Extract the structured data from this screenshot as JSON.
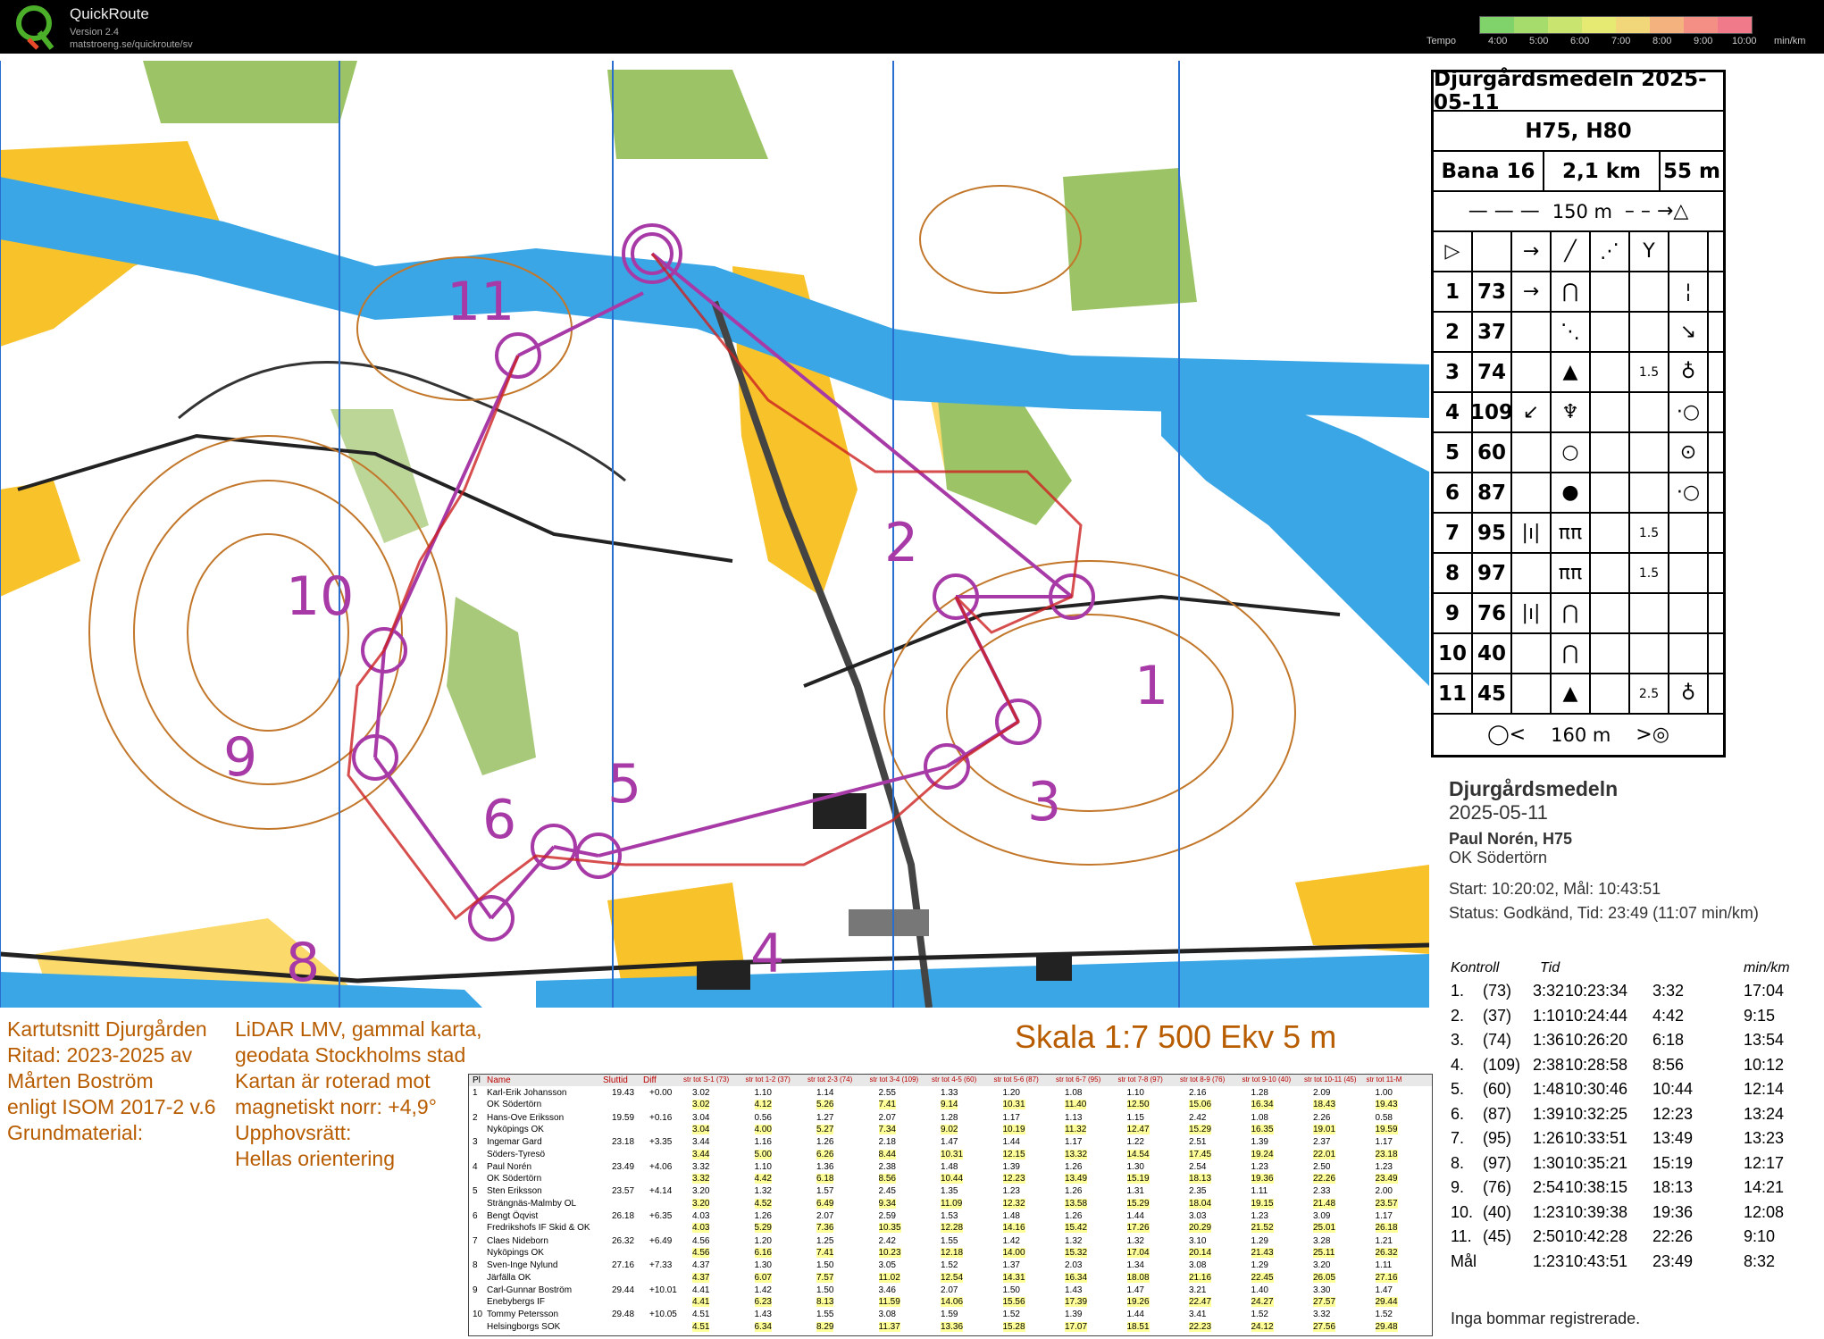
{
  "app": {
    "title": "QuickRoute",
    "version": "Version 2.4",
    "url": "matstroeng.se/quickroute/sv"
  },
  "tempo": {
    "label": "Tempo",
    "ticks": [
      "4:00",
      "5:00",
      "6:00",
      "7:00",
      "8:00",
      "9:00",
      "10:00"
    ],
    "unit": "min/km",
    "colors": [
      "#7fd36a",
      "#a6dc6c",
      "#c9e56f",
      "#e6ea73",
      "#f2d67a",
      "#f4b27f",
      "#f38f84",
      "#f17a8a"
    ]
  },
  "map_notes": {
    "left": [
      "Kartutsnitt Djurgården",
      "Ritad: 2023-2025 av",
      "Mårten Boström",
      "enligt ISOM 2017-2 v.6",
      "Grundmaterial:"
    ],
    "right": [
      "LiDAR LMV, gammal karta,",
      "geodata Stockholms stad",
      "Kartan är roterad mot",
      "magnetiskt norr: +4,9°",
      "Upphovsrätt:",
      "Hellas orientering"
    ],
    "scale": "Skala 1:7 500 Ekv 5 m",
    "control_numbers": [
      "1",
      "2",
      "3",
      "4",
      "5",
      "6",
      "8",
      "9",
      "10",
      "11"
    ]
  },
  "description": {
    "title": "Djurgårdsmedeln 2025-05-11",
    "classes": "H75, H80",
    "course": "Bana 16",
    "length": "2,1 km",
    "climb": "55 m",
    "start_marking": "150 m",
    "finish_marking": "160 m",
    "controls": [
      {
        "no": "1",
        "code": "73",
        "c": "→",
        "d": "⋂",
        "e": "",
        "f": "",
        "h": "¦"
      },
      {
        "no": "2",
        "code": "37",
        "c": "",
        "d": "⋱",
        "e": "",
        "f": "",
        "h": "↘"
      },
      {
        "no": "3",
        "code": "74",
        "c": "",
        "d": "▲",
        "e": "",
        "f": "1.5",
        "h": "♁"
      },
      {
        "no": "4",
        "code": "109",
        "c": "↙",
        "d": "♆",
        "e": "",
        "f": "",
        "h": "·○"
      },
      {
        "no": "5",
        "code": "60",
        "c": "",
        "d": "○",
        "e": "",
        "f": "",
        "h": "⊙"
      },
      {
        "no": "6",
        "code": "87",
        "c": "",
        "d": "●",
        "e": "",
        "f": "",
        "h": "·○"
      },
      {
        "no": "7",
        "code": "95",
        "c": "|ı|",
        "d": "ππ",
        "e": "",
        "f": "1.5",
        "h": ""
      },
      {
        "no": "8",
        "code": "97",
        "c": "",
        "d": "ππ",
        "e": "",
        "f": "1.5",
        "h": ""
      },
      {
        "no": "9",
        "code": "76",
        "c": "|ı|",
        "d": "⋂",
        "e": "",
        "f": "",
        "h": ""
      },
      {
        "no": "10",
        "code": "40",
        "c": "",
        "d": "⋂",
        "e": "",
        "f": "",
        "h": ""
      },
      {
        "no": "11",
        "code": "45",
        "c": "",
        "d": "▲",
        "e": "",
        "f": "2.5",
        "h": "♁"
      }
    ]
  },
  "result": {
    "event": "Djurgårdsmedeln",
    "date": "2025-05-11",
    "runner": "Paul Norén, H75",
    "club": "OK Södertörn",
    "start_finish": "Start: 10:20:02, Mål: 10:43:51",
    "status": "Status: Godkänd, Tid: 23:49 (11:07 min/km)",
    "headers": {
      "kontroll": "Kontroll",
      "tid": "Tid",
      "minkm": "min/km"
    },
    "splits": [
      [
        "1.",
        "(73)",
        "3:32",
        "10:23:34",
        "3:32",
        "17:04"
      ],
      [
        "2.",
        "(37)",
        "1:10",
        "10:24:44",
        "4:42",
        "9:15"
      ],
      [
        "3.",
        "(74)",
        "1:36",
        "10:26:20",
        "6:18",
        "13:54"
      ],
      [
        "4.",
        "(109)",
        "2:38",
        "10:28:58",
        "8:56",
        "10:12"
      ],
      [
        "5.",
        "(60)",
        "1:48",
        "10:30:46",
        "10:44",
        "12:14"
      ],
      [
        "6.",
        "(87)",
        "1:39",
        "10:32:25",
        "12:23",
        "13:24"
      ],
      [
        "7.",
        "(95)",
        "1:26",
        "10:33:51",
        "13:49",
        "13:23"
      ],
      [
        "8.",
        "(97)",
        "1:30",
        "10:35:21",
        "15:19",
        "12:17"
      ],
      [
        "9.",
        "(76)",
        "2:54",
        "10:38:15",
        "18:13",
        "14:21"
      ],
      [
        "10.",
        "(40)",
        "1:23",
        "10:39:38",
        "19:36",
        "12:08"
      ],
      [
        "11.",
        "(45)",
        "2:50",
        "10:42:28",
        "22:26",
        "9:10"
      ],
      [
        "Mål",
        "",
        "1:23",
        "10:43:51",
        "23:49",
        "8:32"
      ]
    ],
    "note": "Inga bommar registrerade."
  },
  "winsplits": {
    "headers": [
      "Pl",
      "Name",
      "Sluttid",
      "Diff",
      "str tot S-1 (73)",
      "str tot 1-2 (37)",
      "str tot 2-3 (74)",
      "str tot 3-4 (109)",
      "str tot 4-5 (60)",
      "str tot 5-6 (87)",
      "str tot 6-7 (95)",
      "str tot 7-8 (97)",
      "str tot 8-9 (76)",
      "str tot 9-10 (40)",
      "str tot 10-11 (45)",
      "str tot 11-M"
    ],
    "rows": [
      {
        "pl": "1",
        "name": "Karl-Erik Johansson",
        "club": "OK Södertörn",
        "time": "19.43",
        "diff": "+0.00",
        "a": [
          "3.02",
          "1.10",
          "1.14",
          "2.55",
          "1.33",
          "1.20",
          "1.08",
          "1.10",
          "2.16",
          "1.28",
          "2.09",
          "1.00"
        ],
        "b": [
          "3.02",
          "4.12",
          "5.26",
          "7.41",
          "9.14",
          "10.31",
          "11.40",
          "12.50",
          "15.06",
          "16.34",
          "18.43",
          "19.43"
        ]
      },
      {
        "pl": "2",
        "name": "Hans-Ove Eriksson",
        "club": "Nyköpings OK",
        "time": "19.59",
        "diff": "+0.16",
        "a": [
          "3.04",
          "0.56",
          "1.27",
          "2.07",
          "1.28",
          "1.17",
          "1.13",
          "1.15",
          "2.42",
          "1.08",
          "2.26",
          "0.58"
        ],
        "b": [
          "3.04",
          "4.00",
          "5.27",
          "7.34",
          "9.02",
          "10.19",
          "11.32",
          "12.47",
          "15.29",
          "16.35",
          "19.01",
          "19.59"
        ]
      },
      {
        "pl": "3",
        "name": "Ingemar Gard",
        "club": "Söders-Tyresö",
        "time": "23.18",
        "diff": "+3.35",
        "a": [
          "3.44",
          "1.16",
          "1.26",
          "2.18",
          "1.47",
          "1.44",
          "1.17",
          "1.22",
          "2.51",
          "1.39",
          "2.37",
          "1.17"
        ],
        "b": [
          "3.44",
          "5.00",
          "6.26",
          "8.44",
          "10.31",
          "12.15",
          "13.32",
          "14.54",
          "17.45",
          "19.24",
          "22.01",
          "23.18"
        ]
      },
      {
        "pl": "4",
        "name": "Paul Norén",
        "club": "OK Södertörn",
        "time": "23.49",
        "diff": "+4.06",
        "a": [
          "3.32",
          "1.10",
          "1.36",
          "2.38",
          "1.48",
          "1.39",
          "1.26",
          "1.30",
          "2.54",
          "1.23",
          "2.50",
          "1.23"
        ],
        "b": [
          "3.32",
          "4.42",
          "6.18",
          "8.56",
          "10.44",
          "12.23",
          "13.49",
          "15.19",
          "18.13",
          "19.36",
          "22.26",
          "23.49"
        ]
      },
      {
        "pl": "5",
        "name": "Sten Eriksson",
        "club": "Strängnäs-Malmby OL",
        "time": "23.57",
        "diff": "+4.14",
        "a": [
          "3.20",
          "1.32",
          "1.57",
          "2.45",
          "1.35",
          "1.23",
          "1.26",
          "1.31",
          "2.35",
          "1.11",
          "2.33",
          "2.00"
        ],
        "b": [
          "3.20",
          "4.52",
          "6.49",
          "9.34",
          "11.09",
          "12.32",
          "13.58",
          "15.29",
          "18.04",
          "19.15",
          "21.48",
          "23.57"
        ]
      },
      {
        "pl": "6",
        "name": "Bengt Öqvist",
        "club": "Fredrikshofs IF Skid & OK",
        "time": "26.18",
        "diff": "+6.35",
        "a": [
          "4.03",
          "1.26",
          "2.07",
          "2.59",
          "1.53",
          "1.48",
          "1.26",
          "1.44",
          "3.03",
          "1.23",
          "3.09",
          "1.17"
        ],
        "b": [
          "4.03",
          "5.29",
          "7.36",
          "10.35",
          "12.28",
          "14.16",
          "15.42",
          "17.26",
          "20.29",
          "21.52",
          "25.01",
          "26.18"
        ]
      },
      {
        "pl": "7",
        "name": "Claes Nideborn",
        "club": "Nyköpings OK",
        "time": "26.32",
        "diff": "+6.49",
        "a": [
          "4.56",
          "1.20",
          "1.25",
          "2.42",
          "1.55",
          "1.42",
          "1.32",
          "1.32",
          "3.10",
          "1.29",
          "3.28",
          "1.21"
        ],
        "b": [
          "4.56",
          "6.16",
          "7.41",
          "10.23",
          "12.18",
          "14.00",
          "15.32",
          "17.04",
          "20.14",
          "21.43",
          "25.11",
          "26.32"
        ]
      },
      {
        "pl": "8",
        "name": "Sven-Inge Nylund",
        "club": "Järfälla OK",
        "time": "27.16",
        "diff": "+7.33",
        "a": [
          "4.37",
          "1.30",
          "1.50",
          "3.05",
          "1.52",
          "1.37",
          "2.03",
          "1.34",
          "3.08",
          "1.29",
          "3.20",
          "1.11"
        ],
        "b": [
          "4.37",
          "6.07",
          "7.57",
          "11.02",
          "12.54",
          "14.31",
          "16.34",
          "18.08",
          "21.16",
          "22.45",
          "26.05",
          "27.16"
        ]
      },
      {
        "pl": "9",
        "name": "Carl-Gunnar Boström",
        "club": "Enebybergs IF",
        "time": "29.44",
        "diff": "+10.01",
        "a": [
          "4.41",
          "1.42",
          "1.50",
          "3.46",
          "2.07",
          "1.50",
          "1.43",
          "1.47",
          "3.21",
          "1.40",
          "3.30",
          "1.47"
        ],
        "b": [
          "4.41",
          "6.23",
          "8.13",
          "11.59",
          "14.06",
          "15.56",
          "17.39",
          "19.26",
          "22.47",
          "24.27",
          "27.57",
          "29.44"
        ]
      },
      {
        "pl": "10",
        "name": "Tommy Petersson",
        "club": "Helsingborgs SOK",
        "time": "29.48",
        "diff": "+10.05",
        "a": [
          "4.51",
          "1.43",
          "1.55",
          "3.08",
          "1.59",
          "1.52",
          "1.39",
          "1.44",
          "3.41",
          "1.52",
          "3.32",
          "1.52"
        ],
        "b": [
          "4.51",
          "6.34",
          "8.29",
          "11.37",
          "13.36",
          "15.28",
          "17.07",
          "18.51",
          "22.23",
          "24.12",
          "27.56",
          "29.48"
        ]
      }
    ]
  }
}
